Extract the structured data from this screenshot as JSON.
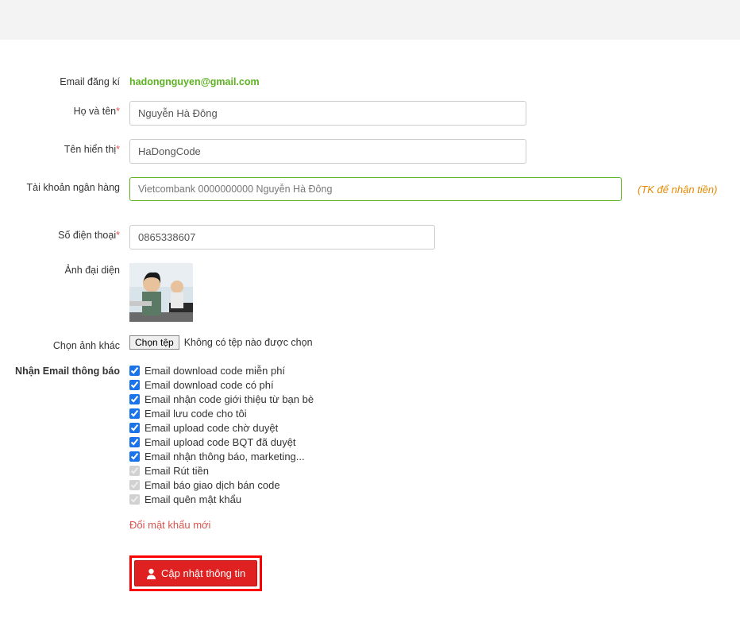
{
  "labels": {
    "email": "Email đăng kí",
    "fullname": "Họ và tên",
    "displayname": "Tên hiển thị",
    "bank": "Tài khoản ngân hàng",
    "phone": "Số điện thoại",
    "avatar": "Ảnh đại diện",
    "choose_other": "Chọn ảnh khác",
    "notify": "Nhận Email thông báo"
  },
  "values": {
    "email": "hadongnguyen@gmail.com",
    "fullname": "Nguyễn Hà Đông",
    "displayname": "HaDongCode",
    "bank": "Vietcombank 0000000000 Nguyễn Hà Đông",
    "phone": "0865338607"
  },
  "bank_hint": "(TK để nhận tiền)",
  "file": {
    "button": "Chọn tệp",
    "status": "Không có tệp nào được chọn"
  },
  "checkboxes": [
    {
      "label": "Email download code miễn phí",
      "checked": true,
      "disabled": false
    },
    {
      "label": "Email download code có phí",
      "checked": true,
      "disabled": false
    },
    {
      "label": "Email nhận code giới thiệu từ bạn bè",
      "checked": true,
      "disabled": false
    },
    {
      "label": "Email lưu code cho tôi",
      "checked": true,
      "disabled": false
    },
    {
      "label": "Email upload code chờ duyệt",
      "checked": true,
      "disabled": false
    },
    {
      "label": "Email upload code BQT đã duyệt",
      "checked": true,
      "disabled": false
    },
    {
      "label": "Email nhận thông báo, marketing...",
      "checked": true,
      "disabled": false
    },
    {
      "label": "Email Rút tiền",
      "checked": true,
      "disabled": true
    },
    {
      "label": "Email báo giao dịch bán code",
      "checked": true,
      "disabled": true
    },
    {
      "label": "Email quên mật khẩu",
      "checked": true,
      "disabled": true
    }
  ],
  "change_password": "Đổi mật khẩu mới",
  "submit": "Cập nhật thông tin"
}
